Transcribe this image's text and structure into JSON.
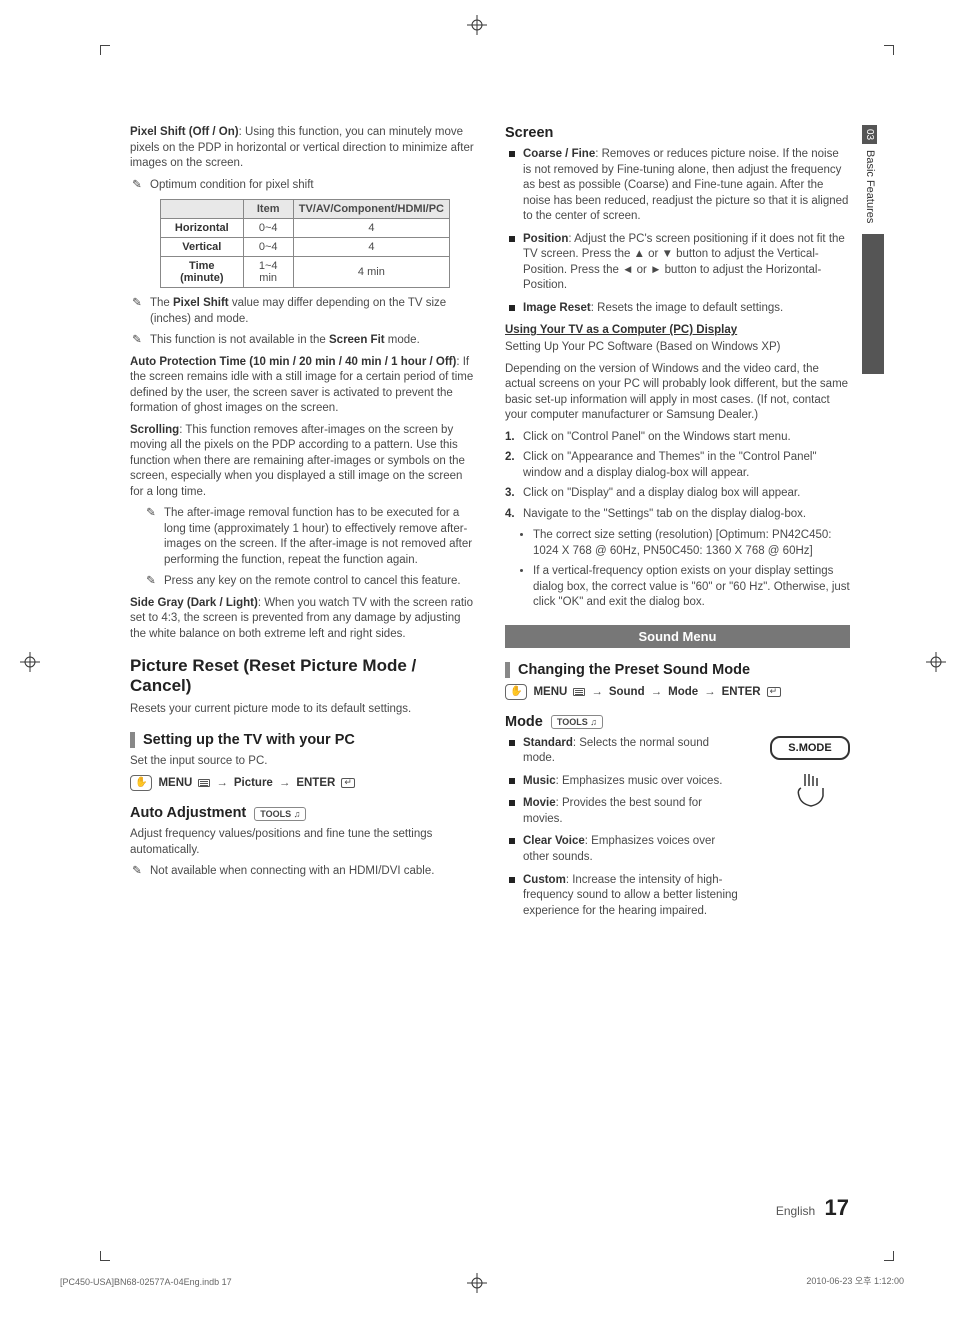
{
  "sideTab": {
    "num": "03",
    "label": "Basic Features"
  },
  "left": {
    "pixelShift": {
      "title": "Pixel Shift (Off / On)",
      "body": ": Using this function, you can minutely move pixels on the PDP in horizontal or vertical direction to minimize after images on the screen.",
      "note1": "Optimum condition for pixel shift",
      "table": {
        "h1": "Item",
        "h2": "TV/AV/Component/HDMI/PC",
        "r1": {
          "a": "Horizontal",
          "b": "0~4",
          "c": "4"
        },
        "r2": {
          "a": "Vertical",
          "b": "0~4",
          "c": "4"
        },
        "r3": {
          "a": "Time (minute)",
          "b": "1~4 min",
          "c": "4 min"
        }
      },
      "note2_pre": "The ",
      "note2_bold": "Pixel Shift",
      "note2_post": " value may differ depending on the TV size (inches) and mode.",
      "note3_pre": "This function is not available in the ",
      "note3_bold": "Screen Fit",
      "note3_post": " mode."
    },
    "autoProt": {
      "title": "Auto Protection Time (10 min / 20 min / 40 min / 1 hour / Off)",
      "body": ": If the screen remains idle with a still image for a certain period of time defined by the user, the screen saver is activated to prevent the formation of ghost images on the screen."
    },
    "scrolling": {
      "title": "Scrolling",
      "body": ": This function removes after-images on the screen by moving all the pixels on the PDP according to a pattern. Use this function when there are remaining after-images or symbols on the screen, especially when you displayed a still image on the screen for a long time.",
      "note1": "The after-image removal function has to be executed for a long time (approximately 1 hour) to effectively remove after-images on the screen. If the after-image is not removed after performing the function, repeat the function again.",
      "note2": "Press any key on the remote control to cancel this feature."
    },
    "sideGray": {
      "title": "Side Gray (Dark / Light)",
      "body": ": When you watch TV with the screen ratio set to 4:3, the screen is prevented from any damage by adjusting the white balance on both extreme left and right sides."
    },
    "pictureReset": {
      "heading": "Picture Reset (Reset Picture Mode / Cancel)",
      "body": "Resets your current picture mode to its default settings."
    },
    "pcSetup": {
      "heading": "Setting up the TV with your PC",
      "body": "Set the input source to PC.",
      "nav": {
        "menu": "MENU",
        "p1": "Picture",
        "p2": "ENTER"
      }
    },
    "autoAdj": {
      "heading": "Auto Adjustment",
      "tools": "TOOLS",
      "body": "Adjust frequency values/positions and fine tune the settings automatically.",
      "note": "Not available when connecting with an HDMI/DVI cable."
    }
  },
  "right": {
    "screen": {
      "heading": "Screen",
      "items": [
        {
          "t": "Coarse / Fine",
          "b": ": Removes or reduces picture noise. If the noise is not removed by Fine-tuning alone, then adjust the frequency as best as possible (Coarse) and Fine-tune again. After the noise has been reduced, readjust the picture so that it is aligned to the center of screen."
        },
        {
          "t": "Position",
          "b": ": Adjust the PC's screen positioning if it does not fit the TV screen. Press the ▲ or ▼ button to adjust the Vertical-Position. Press the ◄ or ► button to adjust the Horizontal-Position."
        },
        {
          "t": "Image Reset",
          "b": ": Resets the image to default settings."
        }
      ]
    },
    "pcDisplay": {
      "heading": "Using Your TV as a Computer (PC) Display",
      "p1": "Setting Up Your PC Software (Based on Windows XP)",
      "p2": "Depending on the version of Windows and the video card, the actual screens on your PC will probably look different, but the same basic set-up information will apply in most cases. (If not, contact your computer manufacturer or Samsung Dealer.)",
      "steps": [
        "Click on \"Control Panel\" on the Windows start menu.",
        "Click on \"Appearance and Themes\" in the \"Control Panel\" window and a display dialog-box will appear.",
        "Click on \"Display\" and a display dialog box will appear.",
        "Navigate to the \"Settings\" tab on the display dialog-box."
      ],
      "bullets": [
        "The correct size setting (resolution) [Optimum: PN42C450: 1024 X 768 @ 60Hz, PN50C450: 1360 X 768 @ 60Hz]",
        "If a vertical-frequency option exists on your display settings dialog box, the correct value is \"60\" or \"60 Hz\". Otherwise, just click \"OK\" and exit the dialog box."
      ]
    },
    "soundMenu": {
      "bar": "Sound Menu"
    },
    "preset": {
      "heading": "Changing the Preset Sound Mode",
      "nav": {
        "menu": "MENU",
        "p1": "Sound",
        "p2": "Mode",
        "p3": "ENTER"
      }
    },
    "mode": {
      "heading": "Mode",
      "tools": "TOOLS",
      "smode": "S.MODE",
      "items": [
        {
          "t": "Standard",
          "b": ": Selects the normal sound mode."
        },
        {
          "t": "Music",
          "b": ": Emphasizes music over voices."
        },
        {
          "t": "Movie",
          "b": ": Provides the best sound for movies."
        },
        {
          "t": "Clear Voice",
          "b": ": Emphasizes voices over other sounds."
        },
        {
          "t": "Custom",
          "b": ": Increase the intensity of high-frequency sound to allow a better listening experience for the hearing impaired."
        }
      ]
    }
  },
  "footer": {
    "lang": "English",
    "page": "17"
  },
  "slug": {
    "left": "[PC450-USA]BN68-02577A-04Eng.indb   17",
    "right": "2010-06-23   오후 1:12:00"
  }
}
